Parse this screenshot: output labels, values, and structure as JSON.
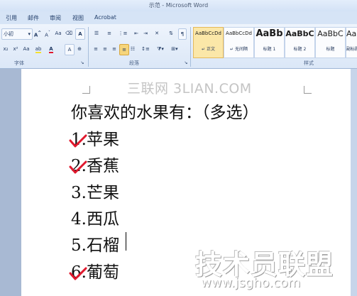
{
  "window": {
    "title": "示范 - Microsoft Word"
  },
  "tabs": [
    "引用",
    "邮件",
    "审阅",
    "视图",
    "Acrobat"
  ],
  "ribbon": {
    "font_size": "小初",
    "groups": {
      "font": "字体",
      "paragraph": "段落",
      "styles": "样式"
    },
    "style_gallery": [
      {
        "sample": "AaBbCcDd",
        "name": "↵ 正文",
        "selected": true
      },
      {
        "sample": "AaBbCcDd",
        "name": "↵ 无间隔",
        "selected": false
      },
      {
        "sample": "AaBb",
        "name": "标题 1",
        "selected": false
      },
      {
        "sample": "AaBbC",
        "name": "标题 2",
        "selected": false
      },
      {
        "sample": "AaBbC",
        "name": "标题",
        "selected": false
      },
      {
        "sample": "AaBbC",
        "name": "副标题",
        "selected": false
      }
    ]
  },
  "document": {
    "question": "你喜欢的水果有：（多选）",
    "options": [
      {
        "text": "1.苹果",
        "checked": true
      },
      {
        "text": "2.香蕉",
        "checked": true
      },
      {
        "text": "3.芒果",
        "checked": false
      },
      {
        "text": "4.西瓜",
        "checked": false
      },
      {
        "text": "5.石榴",
        "checked": false
      },
      {
        "text": "6.葡萄",
        "checked": true
      }
    ]
  },
  "watermarks": {
    "top": "三联网 3LIAN.COM",
    "brand": "技术员联盟",
    "url": "www.jsgho.com"
  },
  "colors": {
    "checkmark": "#e0182d",
    "ribbon_bg": "#dbe7f7",
    "workspace_bg": "#a8b9d3"
  }
}
